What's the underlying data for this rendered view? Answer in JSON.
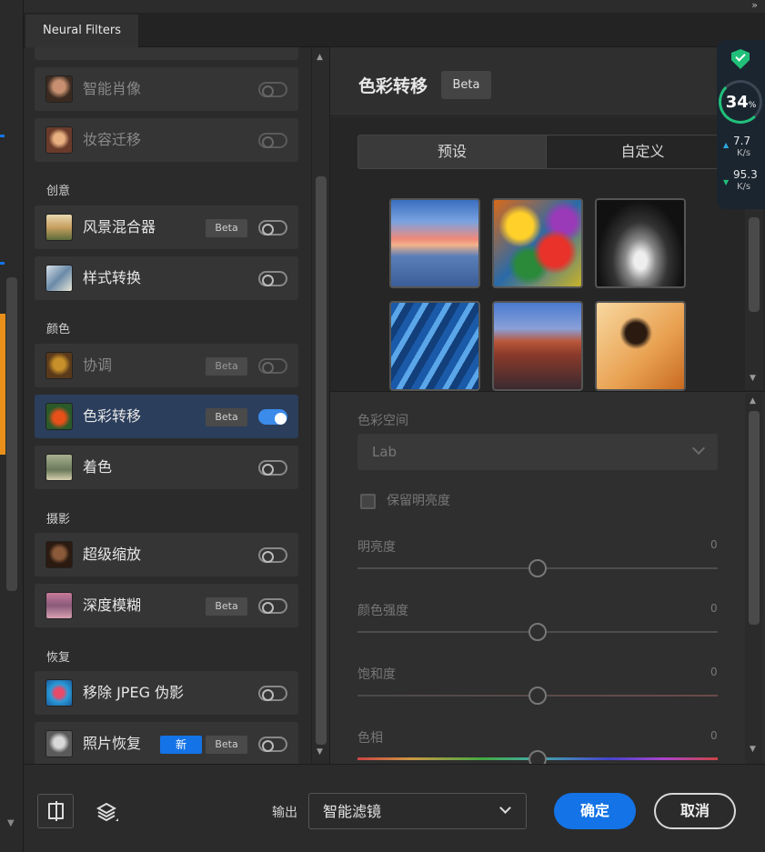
{
  "window": {
    "tab_title": "Neural Filters",
    "expand_glyph": "»"
  },
  "sidebar": {
    "items": [
      {
        "label": "智能肖像",
        "beta": false,
        "new": false,
        "on": false,
        "dim": true
      },
      {
        "label": "妆容迁移",
        "beta": false,
        "new": false,
        "on": false,
        "dim": true
      },
      {
        "label": "风景混合器",
        "beta": true,
        "new": false,
        "on": false,
        "dim": false
      },
      {
        "label": "样式转换",
        "beta": false,
        "new": false,
        "on": false,
        "dim": false
      },
      {
        "label": "协调",
        "beta": true,
        "new": false,
        "on": false,
        "dim": true
      },
      {
        "label": "色彩转移",
        "beta": true,
        "new": false,
        "on": true,
        "dim": false,
        "active": true
      },
      {
        "label": "着色",
        "beta": false,
        "new": false,
        "on": false,
        "dim": false
      },
      {
        "label": "超级缩放",
        "beta": false,
        "new": false,
        "on": false,
        "dim": false
      },
      {
        "label": "深度模糊",
        "beta": true,
        "new": false,
        "on": false,
        "dim": false
      },
      {
        "label": "移除 JPEG 伪影",
        "beta": false,
        "new": false,
        "on": false,
        "dim": false
      },
      {
        "label": "照片恢复",
        "beta": true,
        "new": true,
        "on": false,
        "dim": false
      }
    ],
    "sections": {
      "creative": "创意",
      "color": "颜色",
      "photography": "摄影",
      "restore": "恢复"
    },
    "beta_label": "Beta",
    "new_label": "新"
  },
  "filter": {
    "title": "色彩转移",
    "beta_label": "Beta",
    "tabs": {
      "preset": "预设",
      "custom": "自定义"
    },
    "presets": [
      "sunset-lake",
      "abstract-painting",
      "bw-cathedral",
      "blue-feathers",
      "desert-road",
      "skateboarder"
    ],
    "color_space": {
      "label": "色彩空间",
      "value": "Lab"
    },
    "preserve_luminance": {
      "label": "保留明亮度",
      "checked": false
    },
    "sliders": [
      {
        "label": "明亮度",
        "value": "0"
      },
      {
        "label": "颜色强度",
        "value": "0"
      },
      {
        "label": "饱和度",
        "value": "0"
      },
      {
        "label": "色相",
        "value": "0"
      }
    ]
  },
  "footer": {
    "output_label": "输出",
    "output_value": "智能滤镜",
    "ok_label": "确定",
    "cancel_label": "取消"
  },
  "monitor": {
    "percent": "34",
    "percent_unit": "%",
    "upload": "7.7",
    "download": "95.3",
    "unit": "K/s",
    "up_glyph": "▲",
    "down_glyph": "▼",
    "accent": "#21c07a"
  }
}
